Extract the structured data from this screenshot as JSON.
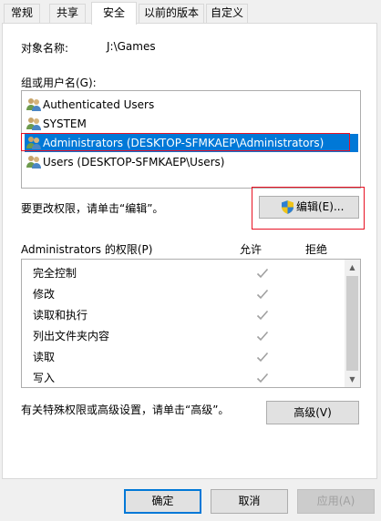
{
  "tabs": [
    {
      "label": "常规"
    },
    {
      "label": "共享"
    },
    {
      "label": "安全"
    },
    {
      "label": "以前的版本"
    },
    {
      "label": "自定义"
    }
  ],
  "object": {
    "label": "对象名称:",
    "value": "J:\\Games"
  },
  "groups": {
    "label": "组或用户名(G):",
    "items": [
      {
        "label": "Authenticated Users",
        "icon": "users-icon"
      },
      {
        "label": "SYSTEM",
        "icon": "users-icon"
      },
      {
        "label": "Administrators (DESKTOP-SFMKAEP\\Administrators)",
        "icon": "users-icon",
        "selected": true
      },
      {
        "label": "Users (DESKTOP-SFMKAEP\\Users)",
        "icon": "users-icon"
      }
    ]
  },
  "change_hint": "要更改权限，请单击“编辑”。",
  "edit_button": "编辑(E)...",
  "permissions": {
    "title": "Administrators 的权限(P)",
    "allow_header": "允许",
    "deny_header": "拒绝",
    "rows": [
      {
        "name": "完全控制",
        "allow": true,
        "deny": false
      },
      {
        "name": "修改",
        "allow": true,
        "deny": false
      },
      {
        "name": "读取和执行",
        "allow": true,
        "deny": false
      },
      {
        "name": "列出文件夹内容",
        "allow": true,
        "deny": false
      },
      {
        "name": "读取",
        "allow": true,
        "deny": false
      },
      {
        "name": "写入",
        "allow": true,
        "deny": false
      }
    ]
  },
  "advanced_hint": "有关特殊权限或高级设置，请单击“高级”。",
  "advanced_button": "高级(V)",
  "footer": {
    "ok": "确定",
    "cancel": "取消",
    "apply": "应用(A)"
  },
  "colors": {
    "selection": "#0078d7",
    "highlight_outline": "#e81123",
    "check": "#a0a0a0"
  }
}
